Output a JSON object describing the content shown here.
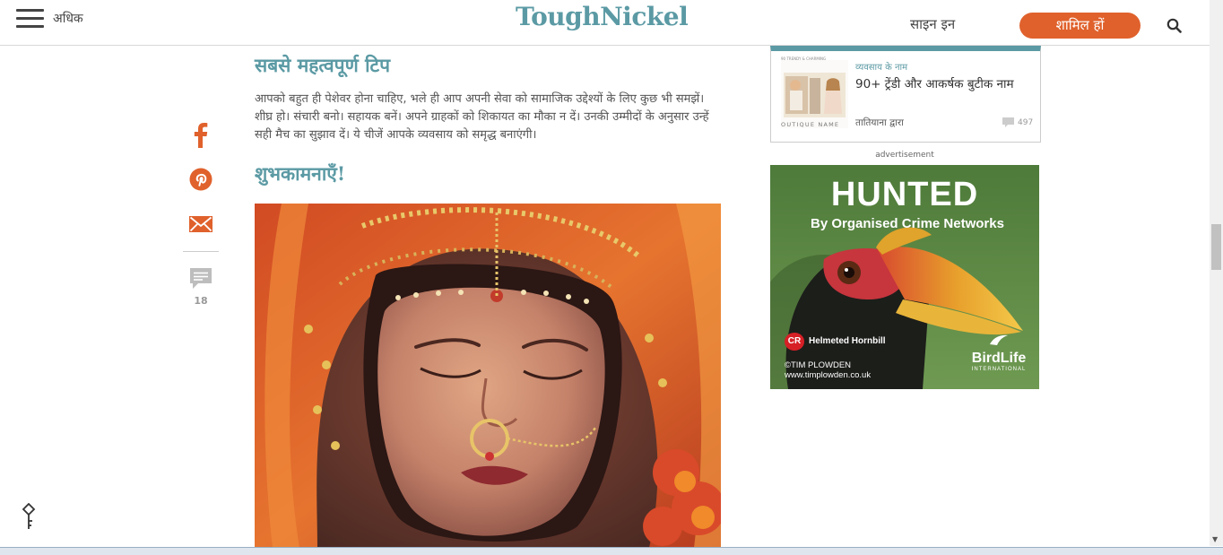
{
  "header": {
    "more_label": "अधिक",
    "logo": "ToughNickel",
    "signin_label": "साइन इन",
    "join_label": "शामिल हों"
  },
  "share": {
    "comment_count": "18"
  },
  "article": {
    "heading_1": "सबसे महत्वपूर्ण टिप",
    "paragraph": "आपको बहुत ही पेशेवर होना चाहिए, भले ही आप अपनी सेवा को सामाजिक उद्देश्यों के लिए कुछ भी समझें। शीघ्र हो। संचारी बनो। सहायक बनें। अपने ग्राहकों को शिकायत का मौका न दें। उनकी उम्मीदों के अनुसार उन्हें सही मैच का सुझाव दें। ये चीजें आपके व्यवसाय को समृद्ध बनाएंगी।",
    "heading_2": "शुभकामनाएँ!"
  },
  "sidebar": {
    "card": {
      "kicker": "व्यवसाय के नाम",
      "title": "90+ ट्रेंडी और आकर्षक बुटीक नाम",
      "author": "तातियाना द्वारा",
      "comments": "497",
      "thumb_caption_top": "90 TRENDY & CHARMING",
      "thumb_caption_bottom": "OUTIQUE NAME"
    },
    "ad_label": "advertisement",
    "ad": {
      "headline": "HUNTED",
      "subline": "By Organised Crime Networks",
      "badge": "CR",
      "species": "Helmeted Hornbill",
      "credit_line_1": "©TIM PLOWDEN",
      "credit_line_2": "www.timplowden.co.uk",
      "brand": "BirdLife",
      "brand_sub": "INTERNATIONAL"
    }
  },
  "colors": {
    "accent_teal": "#5b9aa4",
    "join_orange": "#e0612c",
    "share_orange": "#e0612c"
  }
}
